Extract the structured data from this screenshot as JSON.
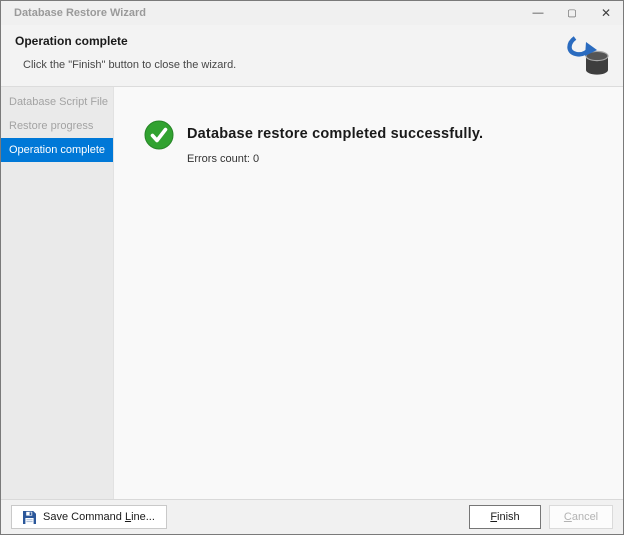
{
  "window": {
    "title": "Database Restore Wizard",
    "controls": {
      "minimize": "—",
      "maximize": "▢",
      "close": "✕"
    }
  },
  "header": {
    "title": "Operation complete",
    "subtitle": "Click the \"Finish\" button to close the wizard."
  },
  "sidebar": {
    "items": [
      {
        "label": "Database Script File",
        "active": false
      },
      {
        "label": "Restore progress",
        "active": false
      },
      {
        "label": "Operation complete",
        "active": true
      }
    ]
  },
  "main": {
    "message": "Database restore completed successfully.",
    "errors_count": "Errors count: 0"
  },
  "footer": {
    "save_button": {
      "pre": "Save Command ",
      "u": "L",
      "post": "ine..."
    },
    "finish_button": {
      "pre": "",
      "u": "F",
      "post": "inish",
      "enabled": true
    },
    "cancel_button": {
      "pre": "",
      "u": "C",
      "post": "ancel",
      "enabled": false
    }
  },
  "colors": {
    "accent_blue": "#0078d7",
    "success_green": "#31a230",
    "arrow_blue": "#2a6bbf",
    "floppy_blue": "#2b579a",
    "cylinder_gray": "#3e3e3e"
  }
}
